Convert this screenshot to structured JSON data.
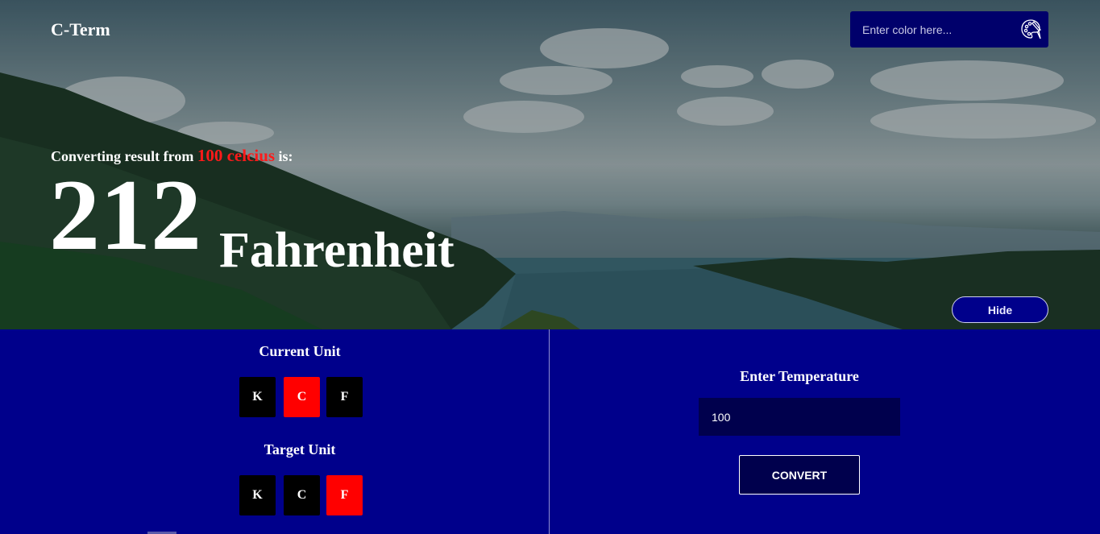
{
  "app": {
    "brand": "C-Term"
  },
  "color_input": {
    "placeholder": "Enter color here...",
    "value": "",
    "icon": "palette-icon"
  },
  "result": {
    "label_prefix": "Converting result from ",
    "from_value": "100 celcius",
    "label_suffix": " is:",
    "number": "212",
    "unit": "Fahrenheit"
  },
  "hide_button": {
    "label": "Hide"
  },
  "current_unit": {
    "title": "Current Unit",
    "options": [
      "K",
      "C",
      "F"
    ],
    "selected": "C"
  },
  "target_unit": {
    "title": "Target Unit",
    "options": [
      "K",
      "C",
      "F"
    ],
    "selected": "F"
  },
  "temperature": {
    "title": "Enter Temperature",
    "value": "100"
  },
  "convert_button": {
    "label": "CONVERT"
  },
  "colors": {
    "panel_bg": "#00008b",
    "active_unit": "#ff0000",
    "inactive_unit": "#000000",
    "input_bg": "#00004d",
    "highlight_text": "#ff1a1a"
  }
}
